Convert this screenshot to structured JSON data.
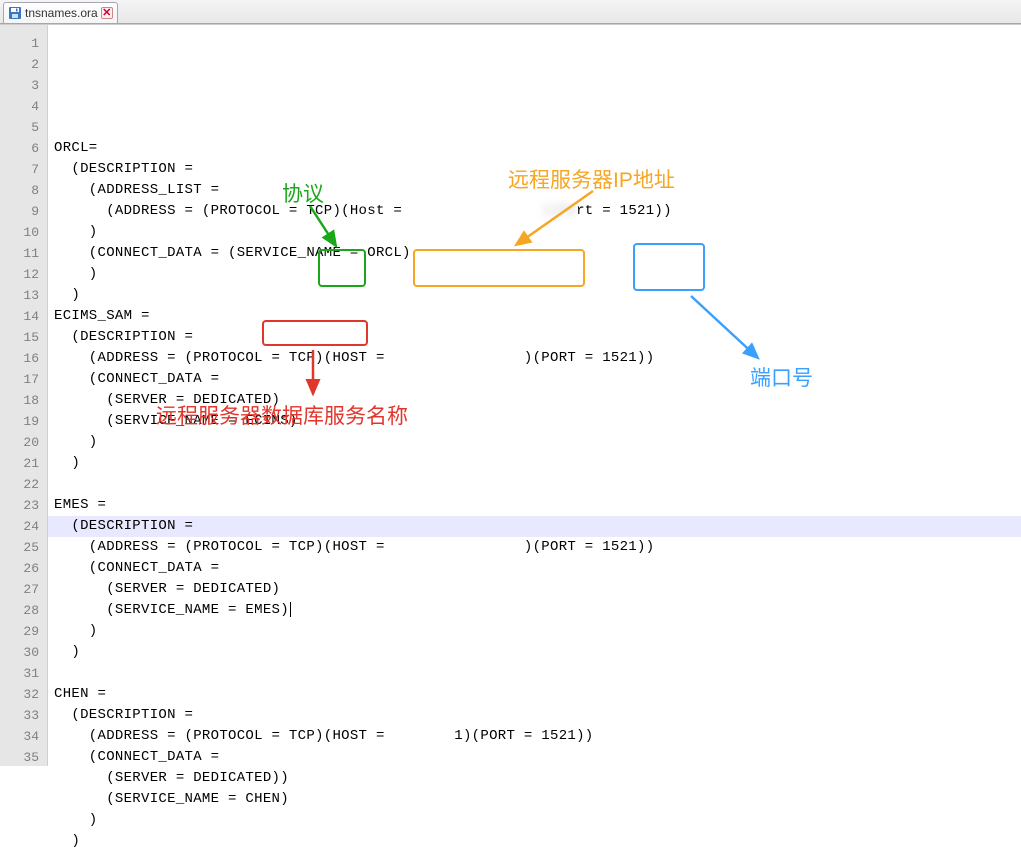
{
  "tab": {
    "filename": "tnsnames.ora"
  },
  "lines": [
    "",
    "ORCL=",
    "  (DESCRIPTION =",
    "    (ADDRESS_LIST =",
    "      (ADDRESS = (PROTOCOL = TCP)(Host =                )(Port = 1521))",
    "    )",
    "    (CONNECT_DATA = (SERVICE_NAME = ORCL)",
    "    )",
    "  )",
    "ECIMS_SAM =",
    "  (DESCRIPTION =",
    "    (ADDRESS = (PROTOCOL = TCP)(HOST =                )(PORT = 1521))",
    "    (CONNECT_DATA =",
    "      (SERVER = DEDICATED)",
    "      (SERVICE_NAME = ECIMS)",
    "    )",
    "  )",
    "",
    "EMES =",
    "  (DESCRIPTION =",
    "    (ADDRESS = (PROTOCOL = TCP)(HOST =                )(PORT = 1521))",
    "    (CONNECT_DATA =",
    "      (SERVER = DEDICATED)",
    "      (SERVICE_NAME = EMES)",
    "    )",
    "  )",
    "",
    "CHEN =",
    "  (DESCRIPTION =",
    "    (ADDRESS = (PROTOCOL = TCP)(HOST =        1)(PORT = 1521))",
    "    (CONNECT_DATA =",
    "      (SERVER = DEDICATED))",
    "      (SERVICE_NAME = CHEN)",
    "    )",
    "  )"
  ],
  "annotations": {
    "protocol_label": "协议",
    "ip_label": "远程服务器IP地址",
    "port_label": "端口号",
    "service_label": "远程服务器数据库服务名称"
  }
}
